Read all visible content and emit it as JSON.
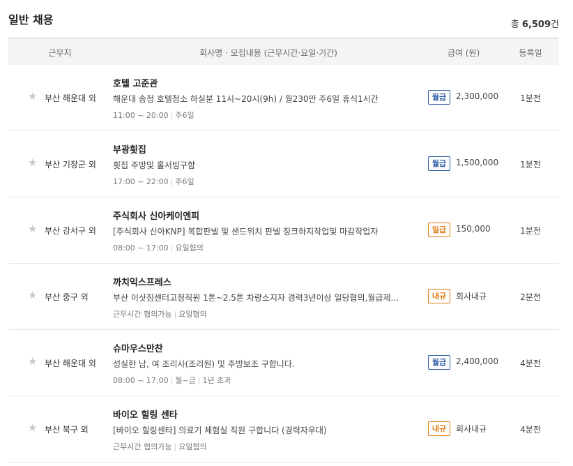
{
  "page": {
    "title": "일반 채용",
    "total_prefix": "총 ",
    "total_count": "6,509",
    "total_unit": "건"
  },
  "columns": {
    "location": "근무지",
    "company": "회사명 · 모집내용 (근무시간·요일·기간)",
    "salary": "급여 (원)",
    "posted": "등록일"
  },
  "icons": {
    "favorite": "star-icon",
    "favorite_color": "#c8c8c8"
  },
  "colors": {
    "monthly_badge": "#2a5aa5",
    "daily_badge": "#e07b14",
    "nego_badge": "#e07b14"
  },
  "jobs": [
    {
      "location": "부산 해운대 외",
      "company": "호텔 고준관",
      "description": "해운대 송정 호텔청소 하실분 11시~20시(9h) / 월230만 주6일 휴식1시간",
      "meta": [
        "11:00 ~ 20:00",
        "주6일"
      ],
      "pay_type": "월급",
      "pay_class": "monthly",
      "amount": "2,300,000",
      "posted": "1분전"
    },
    {
      "location": "부산 기장군 외",
      "company": "부광횟집",
      "description": "횟집 주방및 홀서빙구함",
      "meta": [
        "17:00 ~ 22:00",
        "주6일"
      ],
      "pay_type": "월급",
      "pay_class": "monthly",
      "amount": "1,500,000",
      "posted": "1분전"
    },
    {
      "location": "부산 강서구 외",
      "company": "주식회사 신아케이엔피",
      "description": "[주식회사 신아KNP] 복합판넬 및 샌드위치 판넬 징크하지작업및 마감작업자",
      "meta": [
        "08:00 ~ 17:00",
        "요일협의"
      ],
      "pay_type": "일급",
      "pay_class": "daily",
      "amount": "150,000",
      "posted": "1분전"
    },
    {
      "location": "부산 중구 외",
      "company": "까치익스프레스",
      "description": "부산 이삿짐센터고정직원 1톤~2.5톤 차량소지자 경력3년이상 일당협의,월급제...",
      "meta": [
        "근무시간 협의가능",
        "요일협의"
      ],
      "pay_type": "내규",
      "pay_class": "nego",
      "amount": "회사내규",
      "posted": "2분전"
    },
    {
      "location": "부산 해운대 외",
      "company": "슈마우스만찬",
      "description": "성실한 남, 여 조리사(조리원) 및 주방보조 구합니다.",
      "meta": [
        "08:00 ~ 17:00",
        "월~금",
        "1년 초과"
      ],
      "pay_type": "월급",
      "pay_class": "monthly",
      "amount": "2,400,000",
      "posted": "4분전"
    },
    {
      "location": "부산 북구 외",
      "company": "바이오 힐링 센타",
      "description": "[바이오 힐링센타] 의료기 체험실 직원 구합니다 (경력자우대)",
      "meta": [
        "근무시간 협의가능",
        "요일협의"
      ],
      "pay_type": "내규",
      "pay_class": "nego",
      "amount": "회사내규",
      "posted": "4분전"
    }
  ]
}
